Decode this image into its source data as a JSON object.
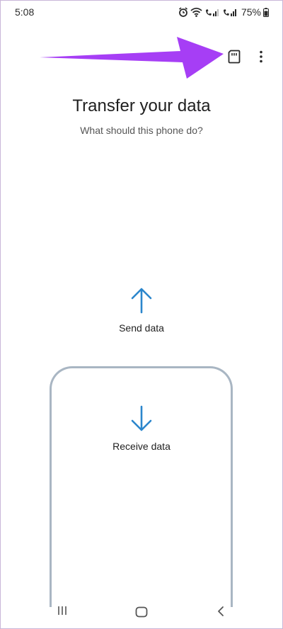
{
  "status_bar": {
    "time": "5:08",
    "battery": "75%"
  },
  "app_bar": {
    "actions": [
      "sd-card-icon",
      "more-vert-icon"
    ],
    "annotation_arrow_color": "#a63ef5"
  },
  "header": {
    "title": "Transfer your data",
    "subtitle": "What should this phone do?"
  },
  "options": {
    "send_label": "Send data",
    "receive_label": "Receive data",
    "arrow_color": "#2b86cc"
  },
  "nav_bar": {
    "buttons": [
      "recents-icon",
      "home-icon",
      "back-icon"
    ]
  }
}
